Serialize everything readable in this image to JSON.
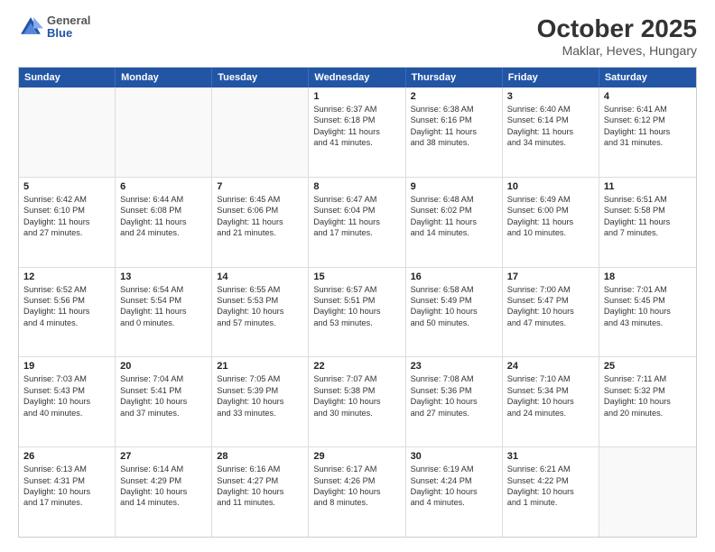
{
  "logo": {
    "line1": "General",
    "line2": "Blue"
  },
  "title": "October 2025",
  "subtitle": "Maklar, Heves, Hungary",
  "days_of_week": [
    "Sunday",
    "Monday",
    "Tuesday",
    "Wednesday",
    "Thursday",
    "Friday",
    "Saturday"
  ],
  "weeks": [
    [
      {
        "day": "",
        "lines": []
      },
      {
        "day": "",
        "lines": []
      },
      {
        "day": "",
        "lines": []
      },
      {
        "day": "1",
        "lines": [
          "Sunrise: 6:37 AM",
          "Sunset: 6:18 PM",
          "Daylight: 11 hours",
          "and 41 minutes."
        ]
      },
      {
        "day": "2",
        "lines": [
          "Sunrise: 6:38 AM",
          "Sunset: 6:16 PM",
          "Daylight: 11 hours",
          "and 38 minutes."
        ]
      },
      {
        "day": "3",
        "lines": [
          "Sunrise: 6:40 AM",
          "Sunset: 6:14 PM",
          "Daylight: 11 hours",
          "and 34 minutes."
        ]
      },
      {
        "day": "4",
        "lines": [
          "Sunrise: 6:41 AM",
          "Sunset: 6:12 PM",
          "Daylight: 11 hours",
          "and 31 minutes."
        ]
      }
    ],
    [
      {
        "day": "5",
        "lines": [
          "Sunrise: 6:42 AM",
          "Sunset: 6:10 PM",
          "Daylight: 11 hours",
          "and 27 minutes."
        ]
      },
      {
        "day": "6",
        "lines": [
          "Sunrise: 6:44 AM",
          "Sunset: 6:08 PM",
          "Daylight: 11 hours",
          "and 24 minutes."
        ]
      },
      {
        "day": "7",
        "lines": [
          "Sunrise: 6:45 AM",
          "Sunset: 6:06 PM",
          "Daylight: 11 hours",
          "and 21 minutes."
        ]
      },
      {
        "day": "8",
        "lines": [
          "Sunrise: 6:47 AM",
          "Sunset: 6:04 PM",
          "Daylight: 11 hours",
          "and 17 minutes."
        ]
      },
      {
        "day": "9",
        "lines": [
          "Sunrise: 6:48 AM",
          "Sunset: 6:02 PM",
          "Daylight: 11 hours",
          "and 14 minutes."
        ]
      },
      {
        "day": "10",
        "lines": [
          "Sunrise: 6:49 AM",
          "Sunset: 6:00 PM",
          "Daylight: 11 hours",
          "and 10 minutes."
        ]
      },
      {
        "day": "11",
        "lines": [
          "Sunrise: 6:51 AM",
          "Sunset: 5:58 PM",
          "Daylight: 11 hours",
          "and 7 minutes."
        ]
      }
    ],
    [
      {
        "day": "12",
        "lines": [
          "Sunrise: 6:52 AM",
          "Sunset: 5:56 PM",
          "Daylight: 11 hours",
          "and 4 minutes."
        ]
      },
      {
        "day": "13",
        "lines": [
          "Sunrise: 6:54 AM",
          "Sunset: 5:54 PM",
          "Daylight: 11 hours",
          "and 0 minutes."
        ]
      },
      {
        "day": "14",
        "lines": [
          "Sunrise: 6:55 AM",
          "Sunset: 5:53 PM",
          "Daylight: 10 hours",
          "and 57 minutes."
        ]
      },
      {
        "day": "15",
        "lines": [
          "Sunrise: 6:57 AM",
          "Sunset: 5:51 PM",
          "Daylight: 10 hours",
          "and 53 minutes."
        ]
      },
      {
        "day": "16",
        "lines": [
          "Sunrise: 6:58 AM",
          "Sunset: 5:49 PM",
          "Daylight: 10 hours",
          "and 50 minutes."
        ]
      },
      {
        "day": "17",
        "lines": [
          "Sunrise: 7:00 AM",
          "Sunset: 5:47 PM",
          "Daylight: 10 hours",
          "and 47 minutes."
        ]
      },
      {
        "day": "18",
        "lines": [
          "Sunrise: 7:01 AM",
          "Sunset: 5:45 PM",
          "Daylight: 10 hours",
          "and 43 minutes."
        ]
      }
    ],
    [
      {
        "day": "19",
        "lines": [
          "Sunrise: 7:03 AM",
          "Sunset: 5:43 PM",
          "Daylight: 10 hours",
          "and 40 minutes."
        ]
      },
      {
        "day": "20",
        "lines": [
          "Sunrise: 7:04 AM",
          "Sunset: 5:41 PM",
          "Daylight: 10 hours",
          "and 37 minutes."
        ]
      },
      {
        "day": "21",
        "lines": [
          "Sunrise: 7:05 AM",
          "Sunset: 5:39 PM",
          "Daylight: 10 hours",
          "and 33 minutes."
        ]
      },
      {
        "day": "22",
        "lines": [
          "Sunrise: 7:07 AM",
          "Sunset: 5:38 PM",
          "Daylight: 10 hours",
          "and 30 minutes."
        ]
      },
      {
        "day": "23",
        "lines": [
          "Sunrise: 7:08 AM",
          "Sunset: 5:36 PM",
          "Daylight: 10 hours",
          "and 27 minutes."
        ]
      },
      {
        "day": "24",
        "lines": [
          "Sunrise: 7:10 AM",
          "Sunset: 5:34 PM",
          "Daylight: 10 hours",
          "and 24 minutes."
        ]
      },
      {
        "day": "25",
        "lines": [
          "Sunrise: 7:11 AM",
          "Sunset: 5:32 PM",
          "Daylight: 10 hours",
          "and 20 minutes."
        ]
      }
    ],
    [
      {
        "day": "26",
        "lines": [
          "Sunrise: 6:13 AM",
          "Sunset: 4:31 PM",
          "Daylight: 10 hours",
          "and 17 minutes."
        ]
      },
      {
        "day": "27",
        "lines": [
          "Sunrise: 6:14 AM",
          "Sunset: 4:29 PM",
          "Daylight: 10 hours",
          "and 14 minutes."
        ]
      },
      {
        "day": "28",
        "lines": [
          "Sunrise: 6:16 AM",
          "Sunset: 4:27 PM",
          "Daylight: 10 hours",
          "and 11 minutes."
        ]
      },
      {
        "day": "29",
        "lines": [
          "Sunrise: 6:17 AM",
          "Sunset: 4:26 PM",
          "Daylight: 10 hours",
          "and 8 minutes."
        ]
      },
      {
        "day": "30",
        "lines": [
          "Sunrise: 6:19 AM",
          "Sunset: 4:24 PM",
          "Daylight: 10 hours",
          "and 4 minutes."
        ]
      },
      {
        "day": "31",
        "lines": [
          "Sunrise: 6:21 AM",
          "Sunset: 4:22 PM",
          "Daylight: 10 hours",
          "and 1 minute."
        ]
      },
      {
        "day": "",
        "lines": []
      }
    ]
  ]
}
